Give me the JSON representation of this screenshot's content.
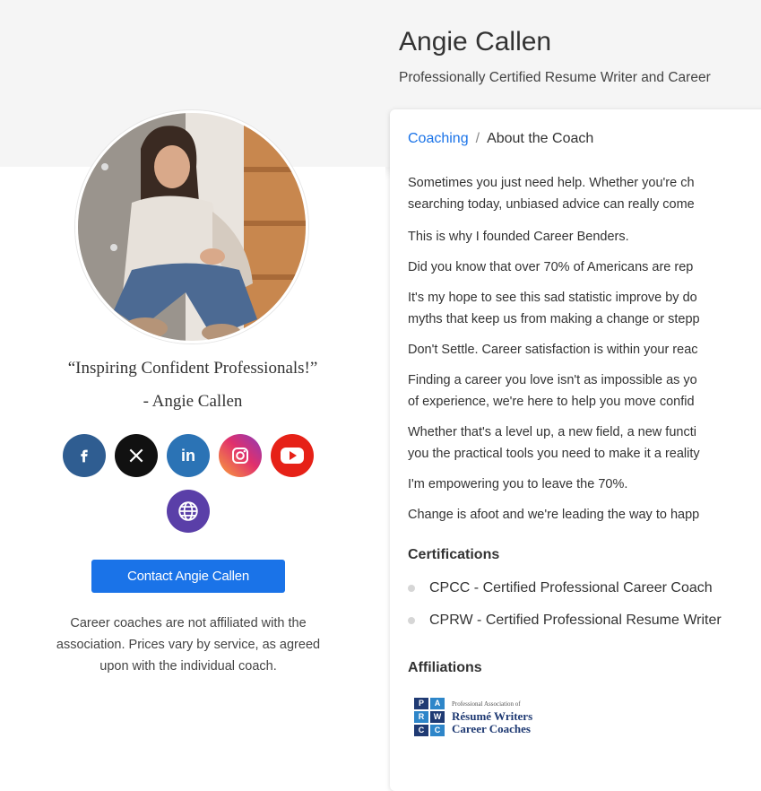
{
  "profile": {
    "name": "Angie Callen",
    "title": "Professionally Certified Resume Writer and Career",
    "quote": "“Inspiring Confident Professionals!”",
    "quote_attribution": "- Angie Callen",
    "contact_label": "Contact Angie Callen",
    "disclaimer_lines": [
      "Career coaches are not affiliated with the",
      "association. Prices vary by service, as agreed",
      "upon with the individual coach."
    ]
  },
  "social": [
    {
      "name": "facebook-icon",
      "glyph": "f",
      "color": "#2f5d91"
    },
    {
      "name": "x-icon",
      "glyph": "𝕏",
      "color": "#111111"
    },
    {
      "name": "linkedin-icon",
      "glyph": "in",
      "color": "#2b73b5"
    },
    {
      "name": "instagram-icon",
      "glyph": "",
      "color": "#e1306c"
    },
    {
      "name": "youtube-icon",
      "glyph": "",
      "color": "#e62117"
    },
    {
      "name": "website-icon",
      "glyph": "",
      "color": "#5a3fa8"
    }
  ],
  "breadcrumb": {
    "link": "Coaching",
    "separator": "/",
    "current": "About the Coach"
  },
  "about": {
    "lines": [
      "Sometimes you just need help. Whether you're ch",
      "searching today, unbiased advice can really come",
      "This is why I founded Career Benders.",
      "Did you know that over 70% of Americans are rep",
      "It's my hope to see this sad statistic improve by do",
      "myths that keep us from making a change or stepp",
      "Don't Settle. Career satisfaction is within your reac",
      "Finding a career you love isn't as impossible as yo",
      "of experience, we're here to help you move confid",
      "Whether that's a level up, a new field, a new functi",
      "you the practical tools you need to make it a reality",
      "I'm empowering you to leave the 70%.",
      "Change is afoot and we're leading the way to happ"
    ]
  },
  "certifications": {
    "heading": "Certifications",
    "items": [
      {
        "code": "CPCC",
        "text": " - Certified Professional Career Coach"
      },
      {
        "code": "CPRW",
        "text": " - Certified Professional Resume Writer"
      }
    ]
  },
  "affiliations": {
    "heading": "Affiliations",
    "logo": {
      "letters": [
        "P",
        "A",
        "R",
        "W",
        "C",
        "C"
      ],
      "line1": "Professional Association of",
      "line2": "Résumé Writers",
      "line3": "Career Coaches"
    }
  },
  "colors": {
    "accent": "#1a73e8",
    "link": "#1a73e8"
  }
}
